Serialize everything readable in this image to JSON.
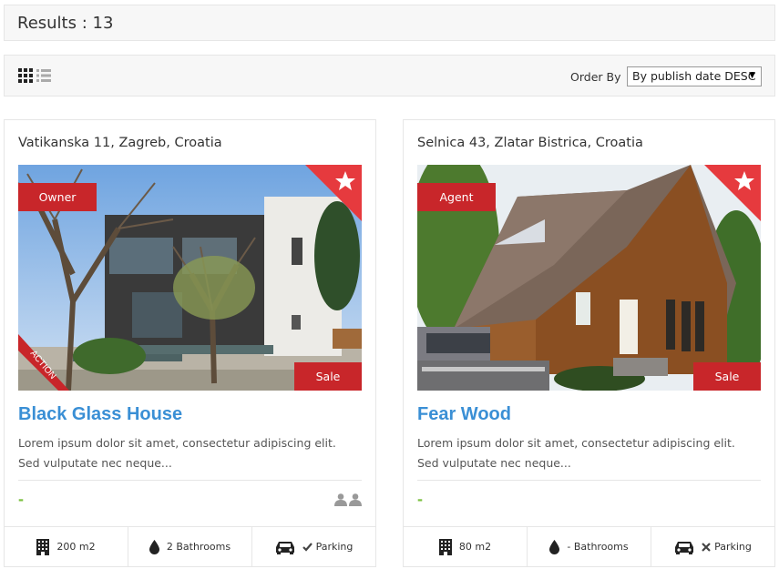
{
  "results": {
    "label": "Results : 13"
  },
  "toolbar": {
    "grid_icon": "grid-view-icon",
    "list_icon": "list-view-icon",
    "order_label": "Order By",
    "order_value": "By publish date DESC"
  },
  "listings": [
    {
      "address": "Vatikanska 11, Zagreb, Croatia",
      "role_badge": "Owner",
      "sale_badge": "Sale",
      "action_ribbon": "ACTION",
      "title": "Black Glass House",
      "description": "Lorem ipsum dolor sit amet, consectetur adipiscing elit. Sed vulputate nec neque...",
      "price": "-",
      "features": {
        "area": "200 m2",
        "bathrooms": "2 Bathrooms",
        "parking": "Parking"
      },
      "parking_available": true
    },
    {
      "address": "Selnica 43, Zlatar Bistrica, Croatia",
      "role_badge": "Agent",
      "sale_badge": "Sale",
      "title": "Fear Wood",
      "description": "Lorem ipsum dolor sit amet, consectetur adipiscing elit. Sed vulputate nec neque...",
      "price": "-",
      "features": {
        "area": "80 m2",
        "bathrooms": "- Bathrooms",
        "parking": "Parking"
      },
      "parking_available": false
    }
  ],
  "colors": {
    "accent_red": "#c8262a",
    "link_blue": "#3a8fd5",
    "price_green": "#7cc242"
  }
}
